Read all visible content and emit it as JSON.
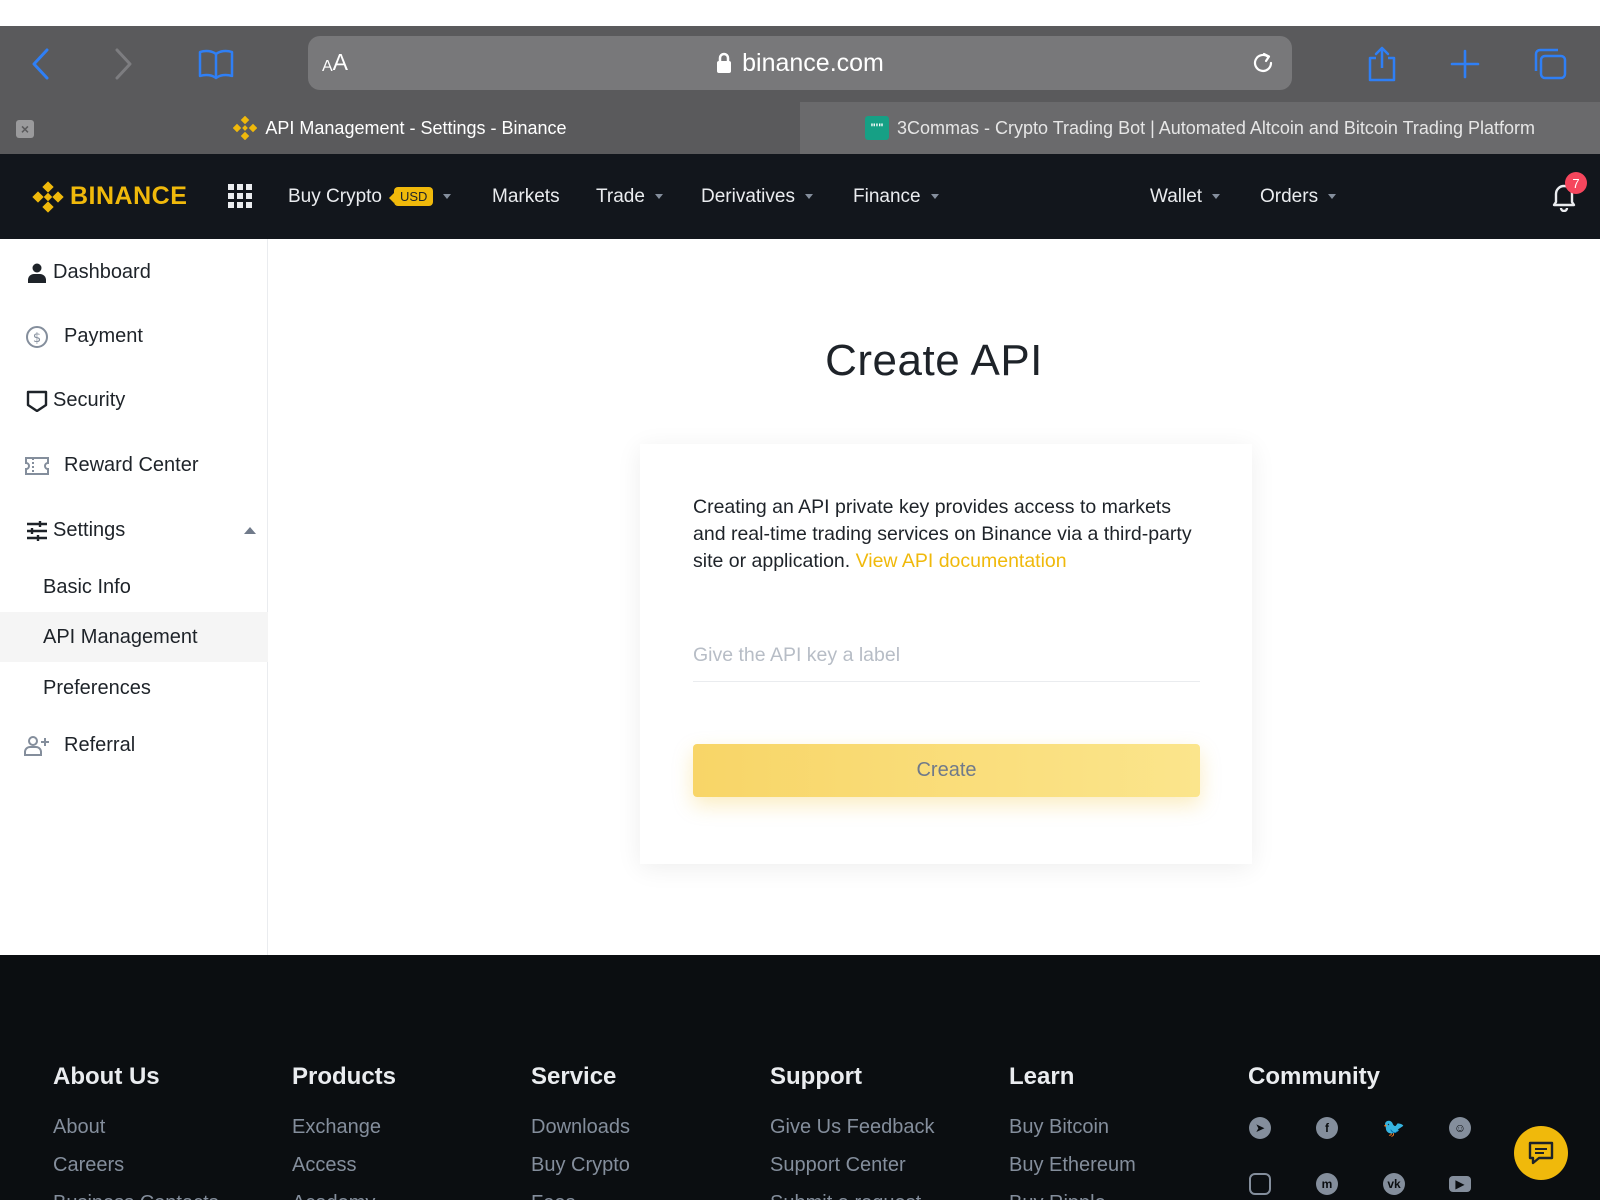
{
  "browser": {
    "text_size_label": {
      "small": "A",
      "big": "A"
    },
    "url": "binance.com",
    "tabs": [
      {
        "title": "API Management - Settings - Binance",
        "active": true
      },
      {
        "title": "3Commas - Crypto Trading Bot | Automated Altcoin and Bitcoin Trading Platform",
        "active": false
      }
    ],
    "colors": {
      "toolbar": "#5a5a5c",
      "icon_blue": "#1a73e8"
    }
  },
  "header": {
    "logo": "BINANCE",
    "nav": {
      "buy_crypto": "Buy Crypto",
      "buy_crypto_badge": "USD",
      "markets": "Markets",
      "trade": "Trade",
      "derivatives": "Derivatives",
      "finance": "Finance",
      "wallet": "Wallet",
      "orders": "Orders"
    },
    "notification_count": "7",
    "colors": {
      "brand": "#f0b90b",
      "background": "#12161c"
    }
  },
  "sidebar": {
    "items": [
      {
        "label": "Dashboard",
        "icon": "person-icon"
      },
      {
        "label": "Payment",
        "icon": "dollar-circle-icon"
      },
      {
        "label": "Security",
        "icon": "shield-icon"
      },
      {
        "label": "Reward Center",
        "icon": "ticket-icon"
      },
      {
        "label": "Settings",
        "icon": "sliders-icon",
        "expanded": true
      },
      {
        "label": "Basic Info"
      },
      {
        "label": "API Management",
        "selected": true
      },
      {
        "label": "Preferences"
      },
      {
        "label": "Referral",
        "icon": "add-user-icon"
      }
    ]
  },
  "main": {
    "title": "Create API",
    "description": "Creating an API private key provides access to markets and real-time trading services on Binance via a third-party site or application.",
    "doc_link": "View API documentation",
    "input_placeholder": "Give the API key a label",
    "input_value": "",
    "create_label": "Create"
  },
  "footer": {
    "columns": [
      {
        "heading": "About Us",
        "links": [
          "About",
          "Careers",
          "Business Contacts"
        ]
      },
      {
        "heading": "Products",
        "links": [
          "Exchange",
          "Access",
          "Academy"
        ]
      },
      {
        "heading": "Service",
        "links": [
          "Downloads",
          "Buy Crypto",
          "Fees"
        ]
      },
      {
        "heading": "Support",
        "links": [
          "Give Us Feedback",
          "Support Center",
          "Submit a request"
        ]
      },
      {
        "heading": "Learn",
        "links": [
          "Buy Bitcoin",
          "Buy Ethereum",
          "Buy Ripple"
        ]
      },
      {
        "heading": "Community",
        "links": []
      }
    ],
    "social_icons": [
      "telegram-icon",
      "facebook-icon",
      "twitter-icon",
      "reddit-icon",
      "instagram-icon",
      "coinmarketcap-icon",
      "vk-icon",
      "youtube-icon"
    ]
  }
}
